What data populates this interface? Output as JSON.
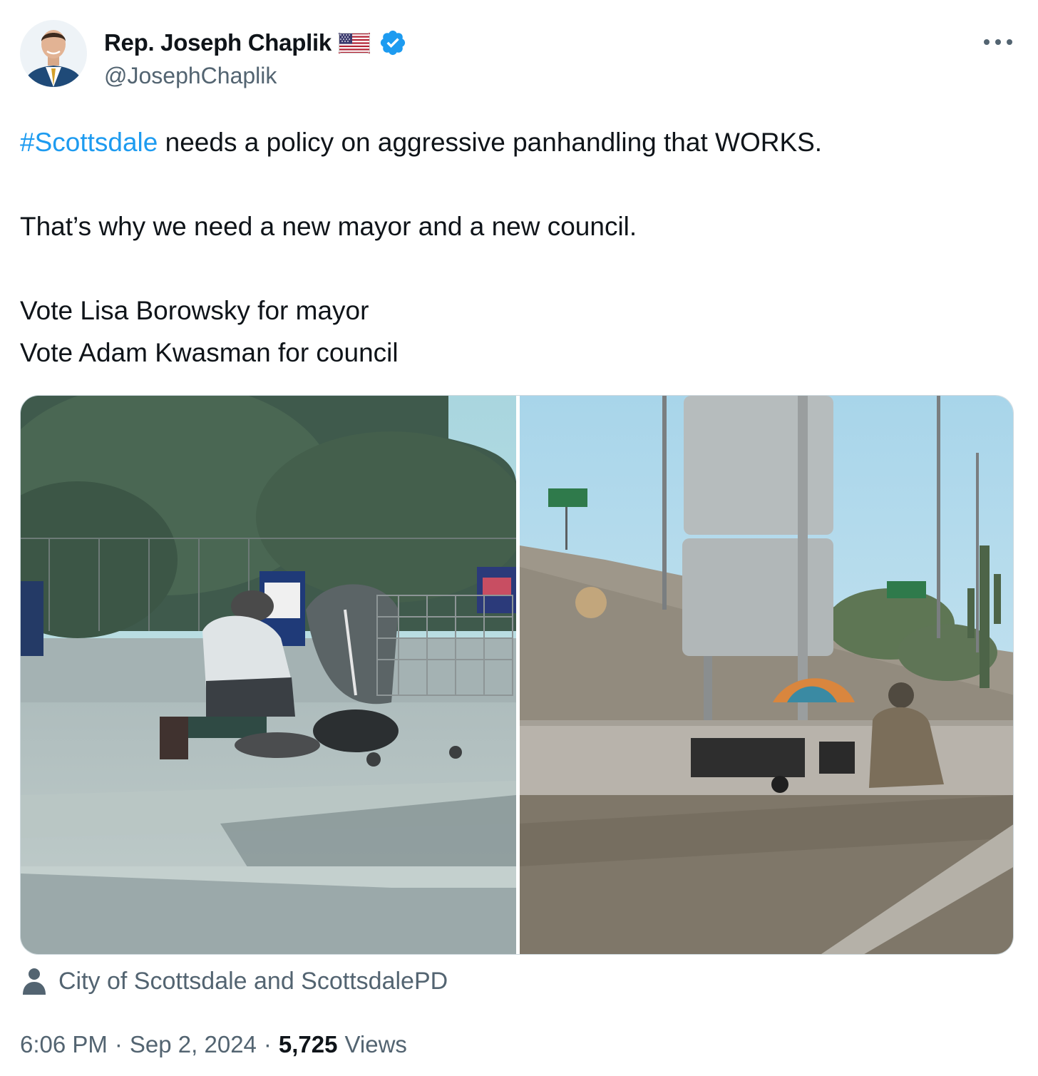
{
  "author": {
    "display_name": "Rep. Joseph Chaplik",
    "handle": "@JosephChaplik",
    "flag_icon": "us-flag-icon",
    "verified_icon": "verified-badge-icon",
    "verified_color": "#1d9bf0"
  },
  "menu": {
    "more_icon": "more-horizontal-icon"
  },
  "tweet": {
    "hashtag": "#Scottsdale",
    "line1_rest": " needs a policy on aggressive panhandling that WORKS.",
    "line2": "That’s why we need a new mayor and a new council.",
    "line3": "Vote Lisa Borowsky for mayor",
    "line4": "Vote Adam Kwasman for council",
    "hashtag_color": "#1d9bf0"
  },
  "media": {
    "photo_count": 2
  },
  "tagged": {
    "icon": "person-icon",
    "text": "City of Scottsdale and ScottsdalePD"
  },
  "meta": {
    "time": "6:06 PM",
    "separator": "·",
    "date": "Sep 2, 2024",
    "views_count": "5,725",
    "views_label": "Views"
  },
  "colors": {
    "text_primary": "#0f1419",
    "text_secondary": "#536471",
    "border": "#cfd9de"
  }
}
